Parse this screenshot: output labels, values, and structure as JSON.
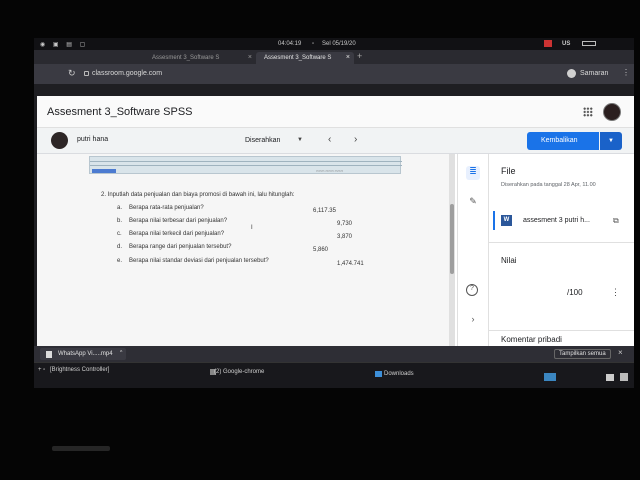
{
  "system_bar": {
    "clock": "04:04:19",
    "date": "Sel 05/19/20",
    "lang": "US"
  },
  "browser": {
    "tabs": [
      {
        "label": "Assesment 3_Software S",
        "active": false
      },
      {
        "label": "Assesment 3_Software S",
        "active": true
      }
    ],
    "url": "classroom.google.com",
    "profile_name": "Samaran"
  },
  "header": {
    "title": "Assesment 3_Software SPSS"
  },
  "subheader": {
    "student_name": "putri hana",
    "status": "Diserahkan",
    "return_button": "Kembalikan"
  },
  "document": {
    "question_header": "2.   Inputlah data penjualan dan biaya promosi di bawah ini, lalu hitunglah:",
    "items": [
      {
        "letter": "a.",
        "text": "Berapa rata-rata penjualan?",
        "answer": "6,117.35"
      },
      {
        "letter": "b.",
        "text": "Berapa nilai terbesar dari penjualan?",
        "answer": "9,730"
      },
      {
        "letter": "c.",
        "text": "Berapa nilai terkecil dari penjualan?",
        "answer": "3,870"
      },
      {
        "letter": "d.",
        "text": "Berapa range dari penjualan tersebut?",
        "answer": "5,860"
      },
      {
        "letter": "e.",
        "text": "Berapa nilai standar deviasi dari penjualan tersebut?",
        "answer": "1,474.741"
      }
    ]
  },
  "panel": {
    "title": "File",
    "submitted": "Diserahkan pada tanggal 28 Apr, 11.00",
    "file_name": "assesment 3 putri h...",
    "grade_label": "Nilai",
    "grade_value": "/100",
    "comment_label": "Komentar pribadi"
  },
  "download_shelf": {
    "file": "WhatsApp Vi.....mp4",
    "show_all": "Tampilkan semua"
  },
  "taskbar": {
    "items": [
      "[Brightness Controller]",
      "(2) Google-chrome",
      "Downloads"
    ]
  },
  "colors": {
    "accent": "#1a73e8",
    "word_icon": "#2b579a"
  }
}
